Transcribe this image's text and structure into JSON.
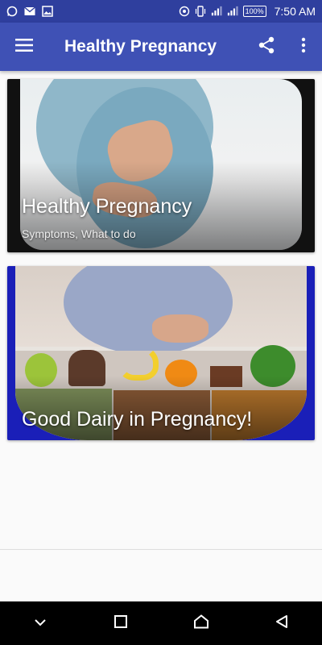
{
  "status_bar": {
    "time": "7:50 AM",
    "battery": "100%",
    "left_icons": [
      "whatsapp-icon",
      "mail-icon",
      "gallery-icon"
    ],
    "right_icons": [
      "hotspot-icon",
      "vibrate-icon",
      "signal-icon",
      "signal-icon",
      "battery-icon"
    ]
  },
  "app_bar": {
    "title": "Healthy Pregnancy",
    "background": "#3f51b5",
    "menu_icon": "hamburger-menu-icon",
    "share_icon": "share-icon",
    "overflow_icon": "more-vert-icon"
  },
  "cards": [
    {
      "title": "Healthy Pregnancy",
      "subtitle": "Symptoms, What to do",
      "image": "pregnant-belly-photo"
    },
    {
      "title": "Good Dairy in Pregnancy!",
      "image": "pregnant-belly-healthy-food-photo"
    }
  ],
  "nav_bar": {
    "buttons": [
      "chevron-down-icon",
      "recents-icon",
      "home-icon",
      "back-icon"
    ]
  }
}
